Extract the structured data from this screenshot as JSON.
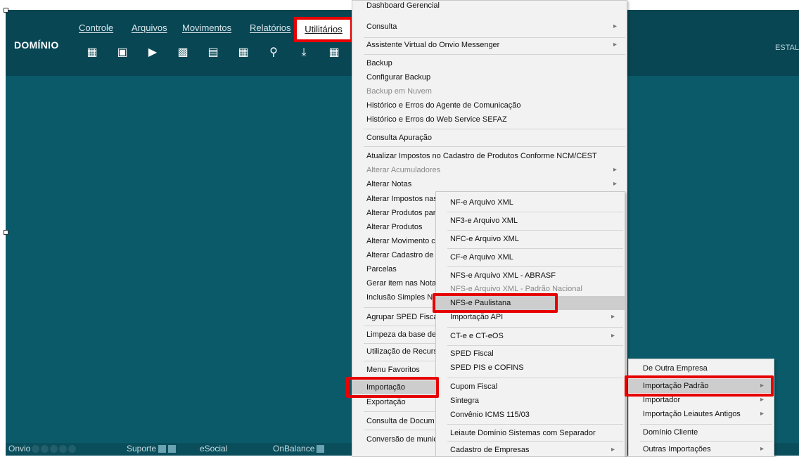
{
  "brand": "DOMÍNIO",
  "menubar": [
    "Controle",
    "Arquivos",
    "Movimentos",
    "Relatórios",
    "Utilitários"
  ],
  "toolbar_icons": [
    "building-icon",
    "puzzle-icon",
    "exit-icon",
    "document-icon",
    "printer-icon",
    "calculator-icon",
    "search-icon",
    "download-icon",
    "grid-icon"
  ],
  "header_right": "ESTAL",
  "statusbar": {
    "onvio": "Onvio",
    "suporte": "Suporte",
    "esocial": "eSocial",
    "onbalance": "OnBalance"
  },
  "main_menu": {
    "top_partial": "Dashboard Gerencial",
    "items": [
      {
        "label": "Consulta",
        "arrow": true
      },
      {
        "label": "Assistente Virtual do Onvio Messenger",
        "arrow": true
      },
      {
        "label": "Backup"
      },
      {
        "label": "Configurar Backup"
      },
      {
        "label": "Backup em Nuvem",
        "disabled": true
      },
      {
        "label": "Histórico e Erros do Agente de Comunicação"
      },
      {
        "label": "Histórico e Erros do Web Service SEFAZ"
      },
      {
        "label": "Consulta Apuração"
      },
      {
        "label": "Atualizar Impostos no Cadastro de Produtos Conforme NCM/CEST"
      },
      {
        "label": "Alterar Acumuladores",
        "disabled": true,
        "arrow": true
      },
      {
        "label": "Alterar Notas",
        "arrow": true
      },
      {
        "label": "Alterar Impostos nas"
      },
      {
        "label": "Alterar Produtos par"
      },
      {
        "label": "Alterar Produtos"
      },
      {
        "label": "Alterar Movimento c"
      },
      {
        "label": "Alterar Cadastro de C"
      },
      {
        "label": "Parcelas"
      },
      {
        "label": "Gerar item nas Nota"
      },
      {
        "label": "Inclusão Simples Na"
      },
      {
        "label": "Agrupar SPED Fiscal"
      },
      {
        "label": "Limpeza da base de"
      },
      {
        "label": "Utilização de Recurs"
      },
      {
        "label": "Menu Favoritos"
      },
      {
        "label": "Importação",
        "highlighted": true
      },
      {
        "label": "Exportação"
      },
      {
        "label": "Consulta de Docum"
      },
      {
        "label": "Conversão de munic"
      }
    ]
  },
  "import_menu": {
    "items": [
      {
        "label": "NF-e Arquivo XML"
      },
      {
        "label": "NF3-e Arquivo XML"
      },
      {
        "label": "NFC-e Arquivo XML"
      },
      {
        "label": "CF-e Arquivo XML"
      },
      {
        "label": "NFS-e Arquivo XML - ABRASF"
      },
      {
        "label": "NFS-e Arquivo XML - Padrão Nacional",
        "disabled": true
      },
      {
        "label": "NFS-e Paulistana",
        "highlighted": true
      },
      {
        "label": "Importação API",
        "arrow": true
      },
      {
        "label": "CT-e e CT-eOS",
        "arrow": true
      },
      {
        "label": "SPED Fiscal"
      },
      {
        "label": "SPED PIS e COFINS"
      },
      {
        "label": "Cupom Fiscal"
      },
      {
        "label": "Sintegra"
      },
      {
        "label": "Convênio ICMS 115/03"
      },
      {
        "label": "Leiaute Domínio Sistemas com Separador"
      },
      {
        "label": "Cadastro de Empresas",
        "arrow": true
      }
    ]
  },
  "padrao_menu": {
    "items": [
      {
        "label": "De Outra Empresa"
      },
      {
        "label": "Importação Padrão",
        "highlighted": true,
        "arrow": true
      },
      {
        "label": "Importador",
        "arrow": true
      },
      {
        "label": "Importação Leiautes Antigos",
        "arrow": true
      },
      {
        "label": "Domínio Cliente"
      },
      {
        "label": "Outras Importações",
        "arrow": true
      }
    ]
  },
  "colors": {
    "app_bg": "#0b5a6a",
    "header_bg": "#084654",
    "highlight_box": "#e60000",
    "menu_bg": "#f2f2f2"
  }
}
